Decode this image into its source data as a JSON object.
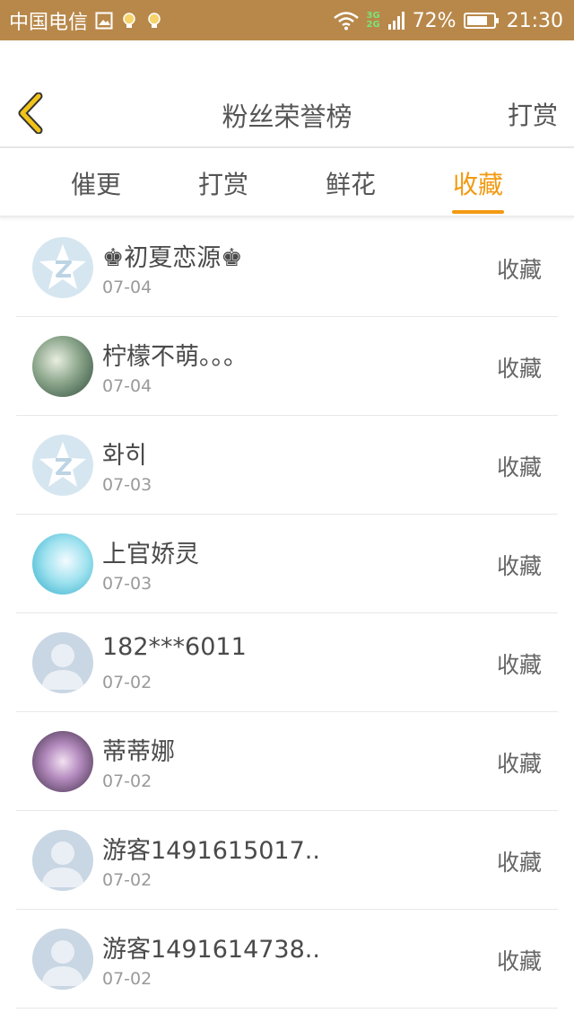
{
  "status_bar": {
    "carrier": "中国电信",
    "net_3g": "3G",
    "net_2g": "2G",
    "battery": "72%",
    "time": "21:30"
  },
  "header": {
    "title": "粉丝荣誉榜",
    "action_label": "打赏"
  },
  "tabs": [
    {
      "label": "催更",
      "active": false
    },
    {
      "label": "打赏",
      "active": false
    },
    {
      "label": "鲜花",
      "active": false
    },
    {
      "label": "收藏",
      "active": true
    }
  ],
  "colors": {
    "status_bar": "#b8884a",
    "accent": "#f29a12",
    "back_icon": "#f2c318"
  },
  "fans": [
    {
      "name": "♚初夏恋源♚",
      "date": "07-04",
      "action": "收藏",
      "avatar": "qq-default-icon"
    },
    {
      "name": "柠檬不萌。。。",
      "date": "07-04",
      "action": "收藏",
      "avatar": "photo-avatar"
    },
    {
      "name": "화히",
      "date": "07-03",
      "action": "收藏",
      "avatar": "qq-default-icon"
    },
    {
      "name": "上官娇灵",
      "date": "07-03",
      "action": "收藏",
      "avatar": "photo-avatar"
    },
    {
      "name": "182***6011",
      "date": "07-02",
      "action": "收藏",
      "avatar": "default-user-icon"
    },
    {
      "name": "蒂蒂娜",
      "date": "07-02",
      "action": "收藏",
      "avatar": "photo-avatar"
    },
    {
      "name": "游客1491615017...",
      "date": "07-02",
      "action": "收藏",
      "avatar": "default-user-icon"
    },
    {
      "name": "游客1491614738...",
      "date": "07-02",
      "action": "收藏",
      "avatar": "default-user-icon"
    }
  ]
}
